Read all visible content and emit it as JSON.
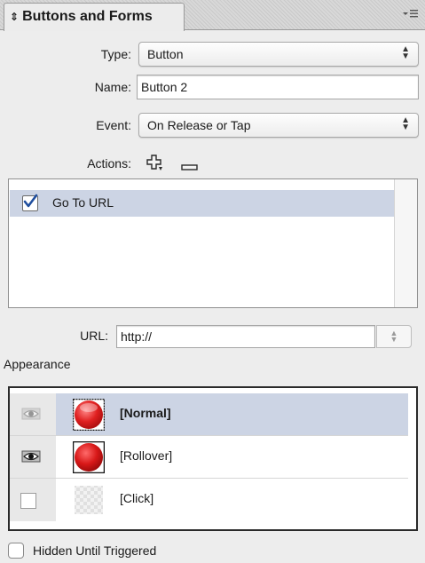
{
  "panel": {
    "tab_title": "Buttons and Forms",
    "tab_chevron": "⇕",
    "menu_icon": "panel-menu-icon"
  },
  "form": {
    "type": {
      "label": "Type:",
      "value": "Button"
    },
    "name": {
      "label": "Name:",
      "value": "Button 2"
    },
    "event": {
      "label": "Event:",
      "value": "On Release or Tap"
    },
    "actions_label": "Actions:"
  },
  "actions": {
    "items": [
      {
        "label": "Go To URL",
        "checked": true
      }
    ]
  },
  "url": {
    "label": "URL:",
    "value": "http://"
  },
  "appearance": {
    "title": "Appearance",
    "states": [
      {
        "label": "[Normal]",
        "selected": true,
        "visible": true,
        "bold": true
      },
      {
        "label": "[Rollover]",
        "selected": false,
        "visible": true,
        "bold": false
      },
      {
        "label": "[Click]",
        "selected": false,
        "visible": false,
        "bold": false
      }
    ]
  },
  "hidden_until_triggered": {
    "label": "Hidden Until Triggered",
    "checked": false
  },
  "colors": {
    "selection": "#ccd4e4",
    "check_accent": "#1f4e9e",
    "button_red": "#e02020"
  }
}
